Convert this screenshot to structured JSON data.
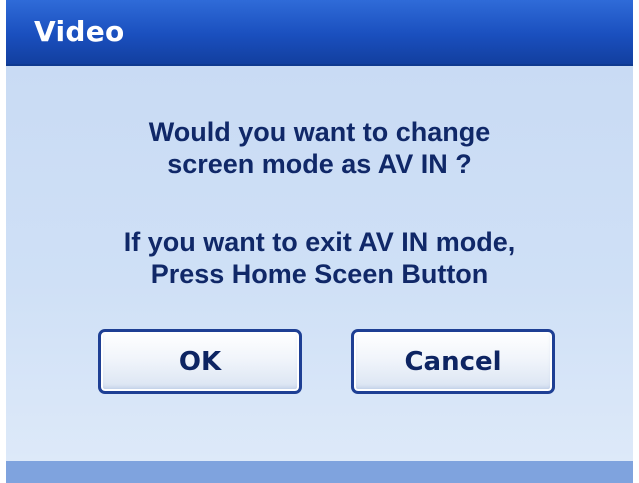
{
  "window": {
    "title": "Video"
  },
  "message": {
    "line1": "Would you want to change",
    "line2": "screen mode as AV IN ?",
    "line3": "If you want to exit AV IN mode,",
    "line4": "Press Home Sceen Button"
  },
  "buttons": {
    "ok_label": "OK",
    "cancel_label": "Cancel"
  },
  "colors": {
    "titlebar": "#1a4fbe",
    "body_background": "#cfe0f6",
    "text": "#102868",
    "button_border": "#1e3f94"
  }
}
